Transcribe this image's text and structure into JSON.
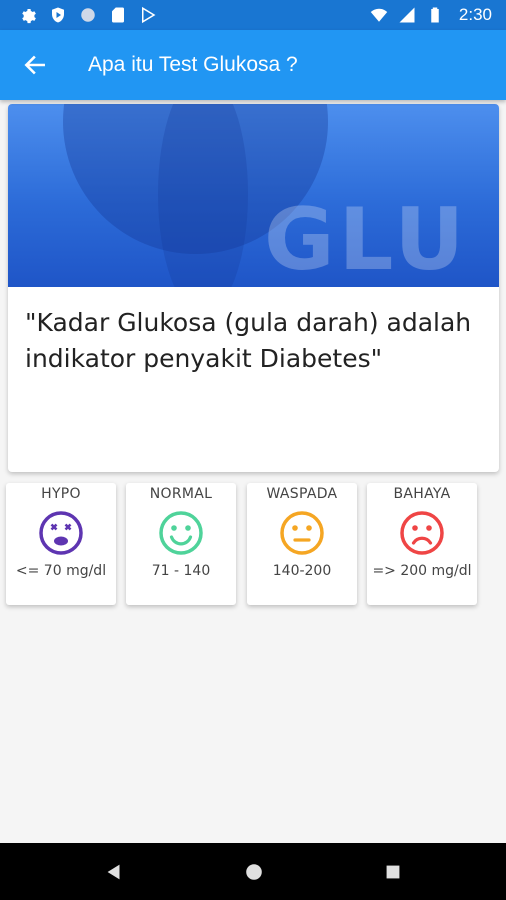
{
  "status_bar": {
    "time": "2:30",
    "icons": [
      "settings-icon",
      "shield-icon",
      "circle-icon",
      "sd-card-icon",
      "play-store-icon",
      "wifi-icon",
      "cell-signal-icon",
      "battery-icon"
    ]
  },
  "app_bar": {
    "title": "Apa itu Test Glukosa ?",
    "back_icon": "arrow-left-icon",
    "bg_color": "#2196f3"
  },
  "main_card": {
    "banner_text": "GLU",
    "quote": "\"Kadar Glukosa (gula darah) adalah indikator penyakit Diabetes\""
  },
  "ranges": [
    {
      "label": "HYPO",
      "value": "<= 70 mg/dl",
      "icon": "dizzy-face-icon",
      "color": "#5e35b1"
    },
    {
      "label": "NORMAL",
      "value": "71 - 140",
      "icon": "smile-face-icon",
      "color": "#4fd39a"
    },
    {
      "label": "WASPADA",
      "value": "140-200",
      "icon": "neutral-face-icon",
      "color": "#f5a623"
    },
    {
      "label": "BAHAYA",
      "value": "=> 200 mg/dl",
      "icon": "sad-face-icon",
      "color": "#ef4545"
    }
  ],
  "nav_bar": {
    "icons": [
      "back-triangle-icon",
      "home-circle-icon",
      "recents-square-icon"
    ]
  }
}
